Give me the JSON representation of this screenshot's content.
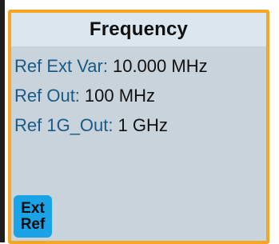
{
  "panel": {
    "title": "Frequency",
    "rows": [
      {
        "label": "Ref Ext Var:",
        "value": "10.000 MHz"
      },
      {
        "label": "Ref Out:",
        "value": "100 MHz"
      },
      {
        "label": "Ref 1G_Out:",
        "value": "1 GHz"
      }
    ],
    "ext_ref_button": {
      "line1": "Ext",
      "line2": "Ref"
    }
  },
  "colors": {
    "border": "#f5a623",
    "panel_bg": "#c8d3db",
    "header_bg": "#dbe6ee",
    "label": "#1a5a86",
    "button": "#1aa3e6"
  }
}
